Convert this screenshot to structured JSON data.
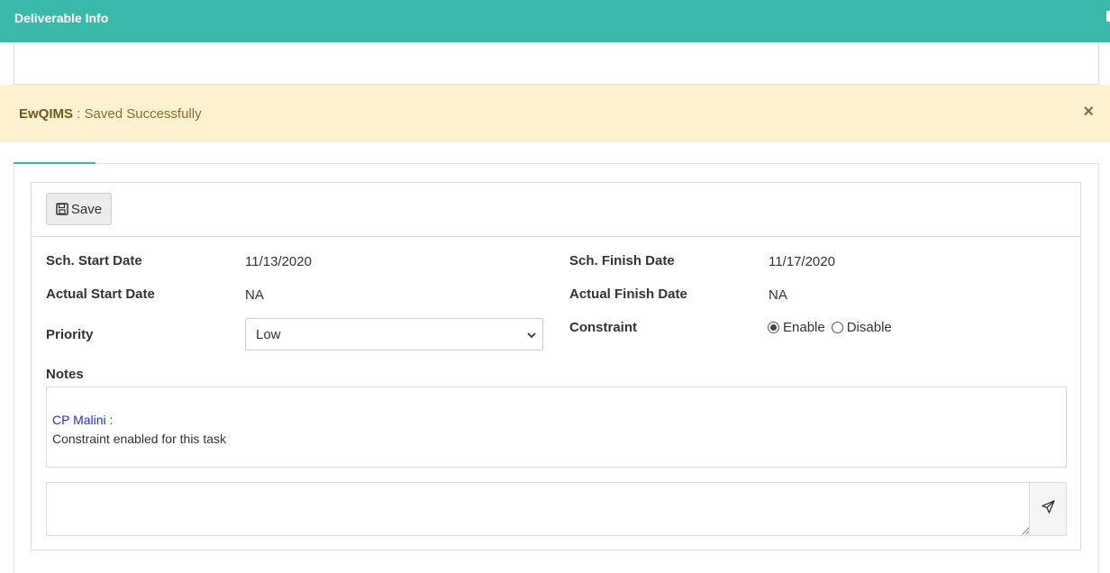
{
  "header": {
    "title": "Deliverable Info",
    "accent_color": "#3ab9a8"
  },
  "alert": {
    "app_name": "EwQIMS",
    "separator": " : ",
    "message": "Saved Successfully",
    "close_symbol": "×",
    "background_color": "#fdf2cf"
  },
  "toolbar": {
    "save_label": "Save",
    "save_icon": "floppy-disk-icon"
  },
  "fields": {
    "sch_start_label": "Sch. Start Date",
    "sch_start_value": "11/13/2020",
    "sch_finish_label": "Sch. Finish Date",
    "sch_finish_value": "11/17/2020",
    "actual_start_label": "Actual Start Date",
    "actual_start_value": "NA",
    "actual_finish_label": "Actual Finish Date",
    "actual_finish_value": "NA",
    "priority_label": "Priority",
    "priority_value": "Low",
    "constraint_label": "Constraint",
    "constraint_options": [
      {
        "label": "Enable",
        "checked": true
      },
      {
        "label": "Disable",
        "checked": false
      }
    ]
  },
  "notes": {
    "label": "Notes",
    "entries": [
      {
        "author": "CP Malini :",
        "text": "Constraint enabled for this task"
      }
    ]
  },
  "comment": {
    "placeholder": "",
    "send_icon": "paper-plane-icon"
  }
}
